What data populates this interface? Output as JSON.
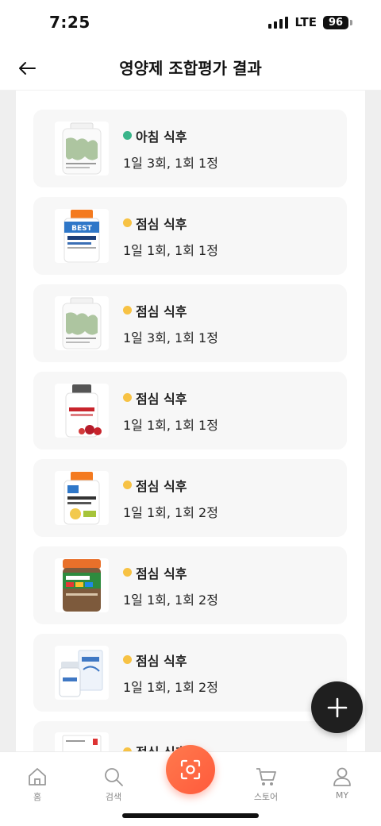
{
  "status_bar": {
    "time": "7:25",
    "network": "LTE",
    "battery": "96"
  },
  "header": {
    "title": "영양제 조합평가 결과"
  },
  "colors": {
    "morning_dot": "#3ab58a",
    "lunch_dot": "#f7c244",
    "scan_gradient": "#ff6a45"
  },
  "supplements": [
    {
      "timing": "아침 식후",
      "dose": "1일 3회, 1회 1정",
      "dot": "green",
      "image": "white-bottle-green-label"
    },
    {
      "timing": "점심 식후",
      "dose": "1일 1회, 1회 1정",
      "dot": "yellow",
      "image": "l-carnitine-bottle"
    },
    {
      "timing": "점심 식후",
      "dose": "1일 3회, 1회 1정",
      "dot": "yellow",
      "image": "white-bottle-green-label"
    },
    {
      "timing": "점심 식후",
      "dose": "1일 1회, 1회 1정",
      "dot": "yellow",
      "image": "lycopene-bottle"
    },
    {
      "timing": "점심 식후",
      "dose": "1일 1회, 1회 2정",
      "dot": "yellow",
      "image": "lutein-bottle"
    },
    {
      "timing": "점심 식후",
      "dose": "1일 1회, 1회 2정",
      "dot": "yellow",
      "image": "multivitamin-jar"
    },
    {
      "timing": "점심 식후",
      "dose": "1일 1회, 1회 2정",
      "dot": "yellow",
      "image": "blue-box-bottle"
    },
    {
      "timing": "점심 식후",
      "dose": "",
      "dot": "yellow",
      "image": "white-box"
    }
  ],
  "bottom_nav": {
    "home": "홈",
    "search": "검색",
    "store": "스토어",
    "my": "MY"
  }
}
